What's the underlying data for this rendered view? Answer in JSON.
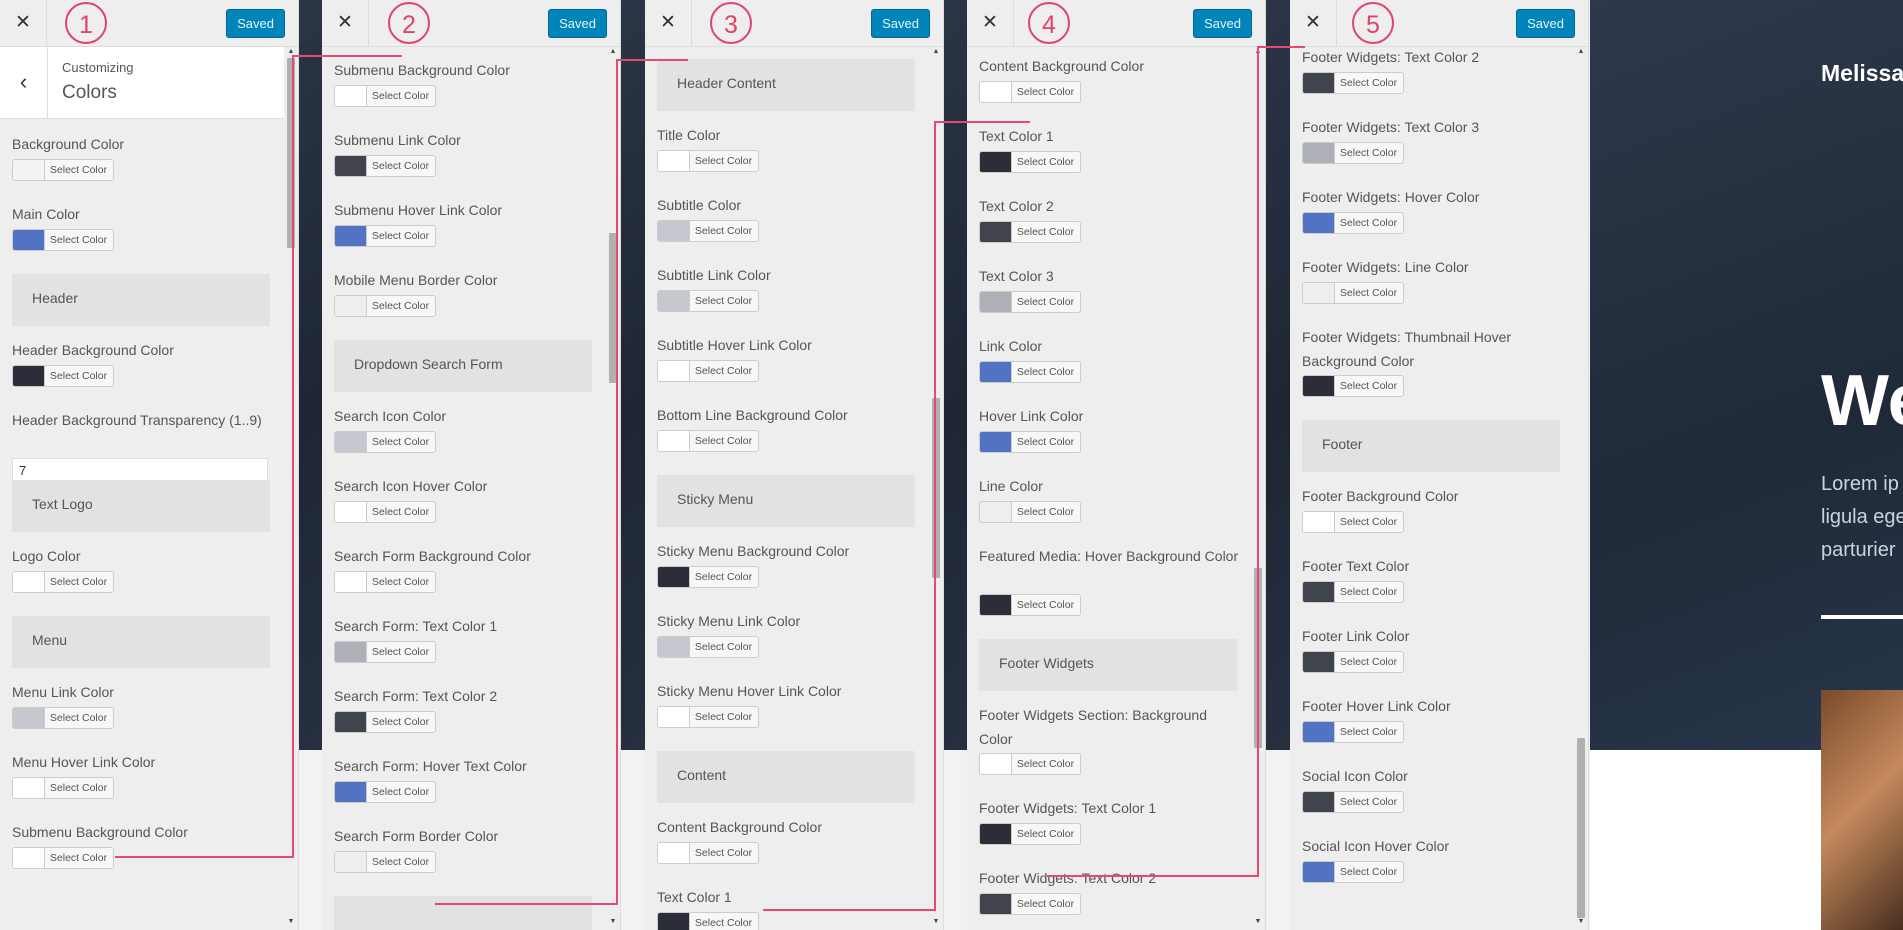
{
  "ui": {
    "close_icon": "close-icon",
    "saved_label": "Saved",
    "select_color_label": "Select Color"
  },
  "colors": {
    "accent": "#0085ba",
    "annotation": "#e8496f",
    "white": "#ffffff",
    "dark": "#2b2e38",
    "gray": "#40444d",
    "light_gray": "#c6c8cf",
    "mid_gray": "#aeb0b7",
    "blue": "#5272c4",
    "off_white": "#eeeeee"
  },
  "panels": [
    {
      "step": "1",
      "breadcrumb": {
        "small": "Customizing",
        "title": "Colors",
        "back_icon": "chevron-left-icon"
      },
      "items": [
        {
          "type": "color",
          "label": "Background Color",
          "swatch": "#f3f3f3"
        },
        {
          "type": "color",
          "label": "Main Color",
          "swatch": "#5272c4"
        },
        {
          "type": "section",
          "label": "Header"
        },
        {
          "type": "color",
          "label": "Header Background Color",
          "swatch": "#2b2e38"
        },
        {
          "type": "text",
          "label": "Header Background Transparency (1..9)",
          "value": "7"
        },
        {
          "type": "section",
          "label": "Text Logo"
        },
        {
          "type": "color",
          "label": "Logo Color",
          "swatch": "#ffffff"
        },
        {
          "type": "section",
          "label": "Menu"
        },
        {
          "type": "color",
          "label": "Menu Link Color",
          "swatch": "#c6c8cf"
        },
        {
          "type": "color",
          "label": "Menu Hover Link Color",
          "swatch": "#ffffff"
        },
        {
          "type": "color",
          "label": "Submenu Background Color",
          "swatch": "#ffffff"
        }
      ]
    },
    {
      "step": "2",
      "items": [
        {
          "type": "color",
          "label": "Submenu Background Color",
          "swatch": "#ffffff"
        },
        {
          "type": "color",
          "label": "Submenu Link Color",
          "swatch": "#40444d"
        },
        {
          "type": "color",
          "label": "Submenu Hover Link Color",
          "swatch": "#5272c4"
        },
        {
          "type": "color",
          "label": "Mobile Menu Border Color",
          "swatch": "#eeeeee"
        },
        {
          "type": "section",
          "label": "Dropdown Search Form"
        },
        {
          "type": "color",
          "label": "Search Icon Color",
          "swatch": "#c6c8cf"
        },
        {
          "type": "color",
          "label": "Search Icon Hover Color",
          "swatch": "#ffffff"
        },
        {
          "type": "color",
          "label": "Search Form Background Color",
          "swatch": "#ffffff"
        },
        {
          "type": "color",
          "label": "Search Form: Text Color 1",
          "swatch": "#aeb0b7"
        },
        {
          "type": "color",
          "label": "Search Form: Text Color 2",
          "swatch": "#40444d"
        },
        {
          "type": "color",
          "label": "Search Form: Hover Text Color",
          "swatch": "#5272c4"
        },
        {
          "type": "color",
          "label": "Search Form Border Color",
          "swatch": "#eeeeee"
        },
        {
          "type": "section",
          "label": ""
        }
      ]
    },
    {
      "step": "3",
      "items": [
        {
          "type": "section",
          "label": "Header Content"
        },
        {
          "type": "color",
          "label": "Title Color",
          "swatch": "#ffffff"
        },
        {
          "type": "color",
          "label": "Subtitle Color",
          "swatch": "#c6c8cf"
        },
        {
          "type": "color",
          "label": "Subtitle Link Color",
          "swatch": "#c6c8cf"
        },
        {
          "type": "color",
          "label": "Subtitle Hover Link Color",
          "swatch": "#ffffff"
        },
        {
          "type": "color",
          "label": "Bottom Line Background Color",
          "swatch": "#ffffff"
        },
        {
          "type": "section",
          "label": "Sticky Menu"
        },
        {
          "type": "color",
          "label": "Sticky Menu Background Color",
          "swatch": "#2b2e38"
        },
        {
          "type": "color",
          "label": "Sticky Menu Link Color",
          "swatch": "#c6c8cf"
        },
        {
          "type": "color",
          "label": "Sticky Menu Hover Link Color",
          "swatch": "#ffffff"
        },
        {
          "type": "section",
          "label": "Content"
        },
        {
          "type": "color",
          "label": "Content Background Color",
          "swatch": "#ffffff"
        },
        {
          "type": "color",
          "label": "Text Color 1",
          "swatch": "#2b2e38"
        }
      ]
    },
    {
      "step": "4",
      "items": [
        {
          "type": "color",
          "label": "Content Background Color",
          "swatch": "#ffffff"
        },
        {
          "type": "color",
          "label": "Text Color 1",
          "swatch": "#2b2e38"
        },
        {
          "type": "color",
          "label": "Text Color 2",
          "swatch": "#40444d"
        },
        {
          "type": "color",
          "label": "Text Color 3",
          "swatch": "#aeb0b7"
        },
        {
          "type": "color",
          "label": "Link Color",
          "swatch": "#5272c4"
        },
        {
          "type": "color",
          "label": "Hover Link Color",
          "swatch": "#5272c4"
        },
        {
          "type": "color",
          "label": "Line Color",
          "swatch": "#eeeeee"
        },
        {
          "type": "color",
          "label": "Featured Media: Hover Background Color",
          "swatch": "#2b2e38"
        },
        {
          "type": "section",
          "label": "Footer Widgets"
        },
        {
          "type": "color",
          "label": "Footer Widgets Section: Background Color",
          "swatch": "#ffffff"
        },
        {
          "type": "color",
          "label": "Footer Widgets: Text Color 1",
          "swatch": "#2b2e38"
        },
        {
          "type": "color",
          "label": "Footer Widgets: Text Color 2",
          "swatch": "#40444d"
        }
      ]
    },
    {
      "step": "5",
      "items": [
        {
          "type": "color",
          "label": "Footer Widgets: Text Color 2",
          "swatch": "#40444d"
        },
        {
          "type": "color",
          "label": "Footer Widgets: Text Color 3",
          "swatch": "#aeb0b7"
        },
        {
          "type": "color",
          "label": "Footer Widgets: Hover Color",
          "swatch": "#5272c4"
        },
        {
          "type": "color",
          "label": "Footer Widgets: Line Color",
          "swatch": "#eeeeee"
        },
        {
          "type": "color",
          "label": "Footer Widgets: Thumbnail Hover Background Color",
          "swatch": "#2b2e38"
        },
        {
          "type": "section",
          "label": "Footer"
        },
        {
          "type": "color",
          "label": "Footer Background Color",
          "swatch": "#ffffff"
        },
        {
          "type": "color",
          "label": "Footer Text Color",
          "swatch": "#40444d"
        },
        {
          "type": "color",
          "label": "Footer Link Color",
          "swatch": "#40444d"
        },
        {
          "type": "color",
          "label": "Footer Hover Link Color",
          "swatch": "#5272c4"
        },
        {
          "type": "color",
          "label": "Social Icon Color",
          "swatch": "#40444d"
        },
        {
          "type": "color",
          "label": "Social Icon Hover Color",
          "swatch": "#5272c4"
        }
      ]
    }
  ],
  "preview": {
    "site_title": "Melissa",
    "headline": "We",
    "paragraph_lines": [
      "Lorem ip",
      "ligula ege",
      "parturier"
    ]
  }
}
